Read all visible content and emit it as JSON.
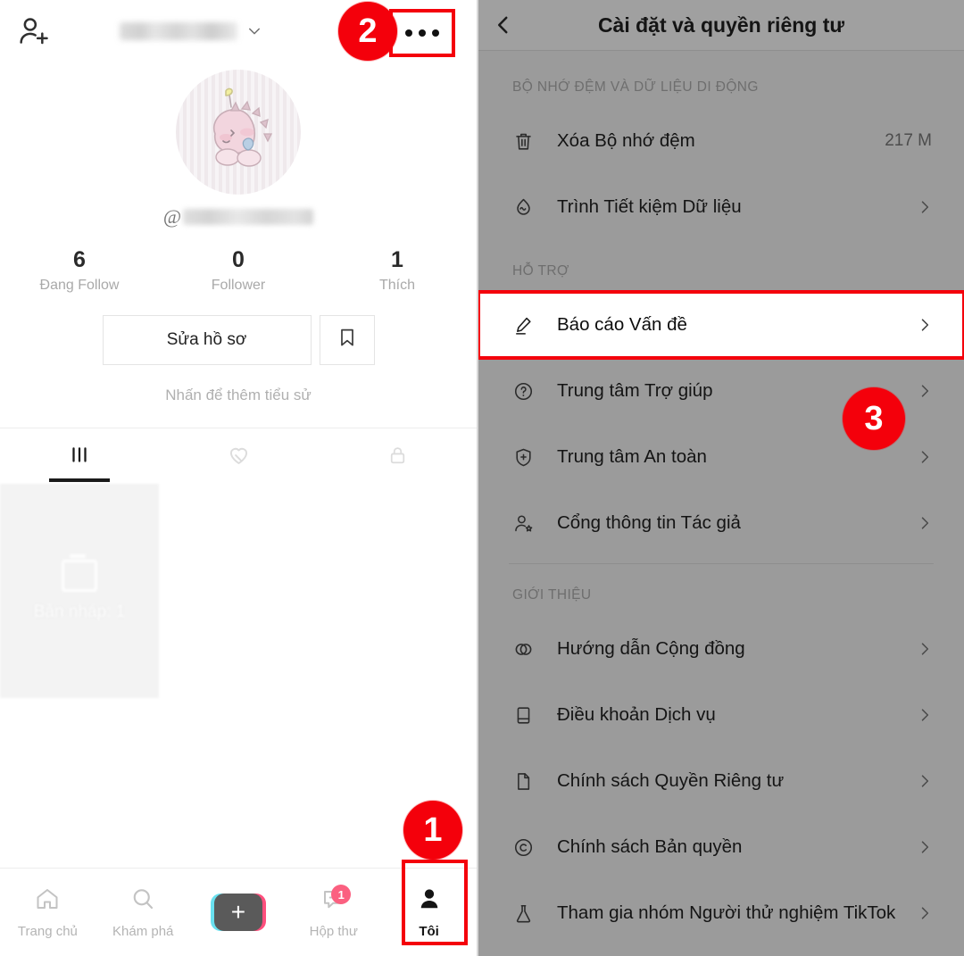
{
  "profile": {
    "topbar": {
      "add_friend_icon": "add-person-icon",
      "username_masked": "",
      "chevron_icon": "chevron-down-icon",
      "more_icon": "more-options-icon"
    },
    "avatar": {
      "alt": "pink-dinosaur-avatar"
    },
    "handle": {
      "at": "@",
      "value_masked": ""
    },
    "stats": [
      {
        "num": "6",
        "label": "Đang Follow"
      },
      {
        "num": "0",
        "label": "Follower"
      },
      {
        "num": "1",
        "label": "Thích"
      }
    ],
    "edit_profile_label": "Sửa hồ sơ",
    "bookmark_icon": "bookmark-icon",
    "bio_hint": "Nhấn để thêm tiểu sử",
    "tabs": [
      {
        "name": "posts-tab",
        "icon": "grid-posts-icon",
        "active": true
      },
      {
        "name": "liked-tab",
        "icon": "heart-slash-icon",
        "active": false
      },
      {
        "name": "private-tab",
        "icon": "lock-icon",
        "active": false
      }
    ],
    "draft": {
      "icon": "draft-stack-icon",
      "label": "Bản nháp: 1"
    },
    "bottom_nav": [
      {
        "name": "home",
        "label": "Trang chủ",
        "icon": "home-icon",
        "active": false
      },
      {
        "name": "discover",
        "label": "Khám phá",
        "icon": "search-icon",
        "active": false
      },
      {
        "name": "create",
        "label": "",
        "icon": "plus-icon",
        "active": false
      },
      {
        "name": "inbox",
        "label": "Hộp thư",
        "icon": "message-icon",
        "active": false,
        "badge": "1"
      },
      {
        "name": "me",
        "label": "Tôi",
        "icon": "person-icon",
        "active": true
      }
    ]
  },
  "settings": {
    "header": {
      "back_icon": "chevron-left-icon",
      "title": "Cài đặt và quyền riêng tư"
    },
    "sections": [
      {
        "header": "BỘ NHỚ ĐỆM VÀ DỮ LIỆU DI ĐỘNG",
        "rows": [
          {
            "label": "Xóa Bộ nhớ đệm",
            "icon": "trash-icon",
            "value": "217 M",
            "chevron": false
          },
          {
            "label": "Trình Tiết kiệm Dữ liệu",
            "icon": "data-saver-icon",
            "value": "",
            "chevron": true
          }
        ]
      },
      {
        "header": "HỖ TRỢ",
        "rows": [
          {
            "label": "Báo cáo Vấn đề",
            "icon": "pencil-icon",
            "value": "",
            "chevron": true,
            "highlight": true
          },
          {
            "label": "Trung tâm Trợ giúp",
            "icon": "question-circle-icon",
            "value": "",
            "chevron": true
          },
          {
            "label": "Trung tâm An toàn",
            "icon": "shield-plus-icon",
            "value": "",
            "chevron": true
          },
          {
            "label": "Cổng thông tin Tác giả",
            "icon": "person-star-icon",
            "value": "",
            "chevron": true
          }
        ]
      },
      {
        "header": "GIỚI THIỆU",
        "rows": [
          {
            "label": "Hướng dẫn Cộng đồng",
            "icon": "two-circles-icon",
            "value": "",
            "chevron": true
          },
          {
            "label": "Điều khoản Dịch vụ",
            "icon": "book-icon",
            "value": "",
            "chevron": true
          },
          {
            "label": "Chính sách Quyền Riêng tư",
            "icon": "document-icon",
            "value": "",
            "chevron": true
          },
          {
            "label": "Chính sách Bản quyền",
            "icon": "copyright-icon",
            "value": "",
            "chevron": true
          },
          {
            "label": "Tham gia nhóm Người thử nghiệm TikTok",
            "icon": "flask-icon",
            "value": "",
            "chevron": true
          }
        ]
      }
    ]
  },
  "annotations": {
    "step_1": "1",
    "step_2": "2",
    "step_3": "3",
    "accent_color": "#f4000b"
  }
}
